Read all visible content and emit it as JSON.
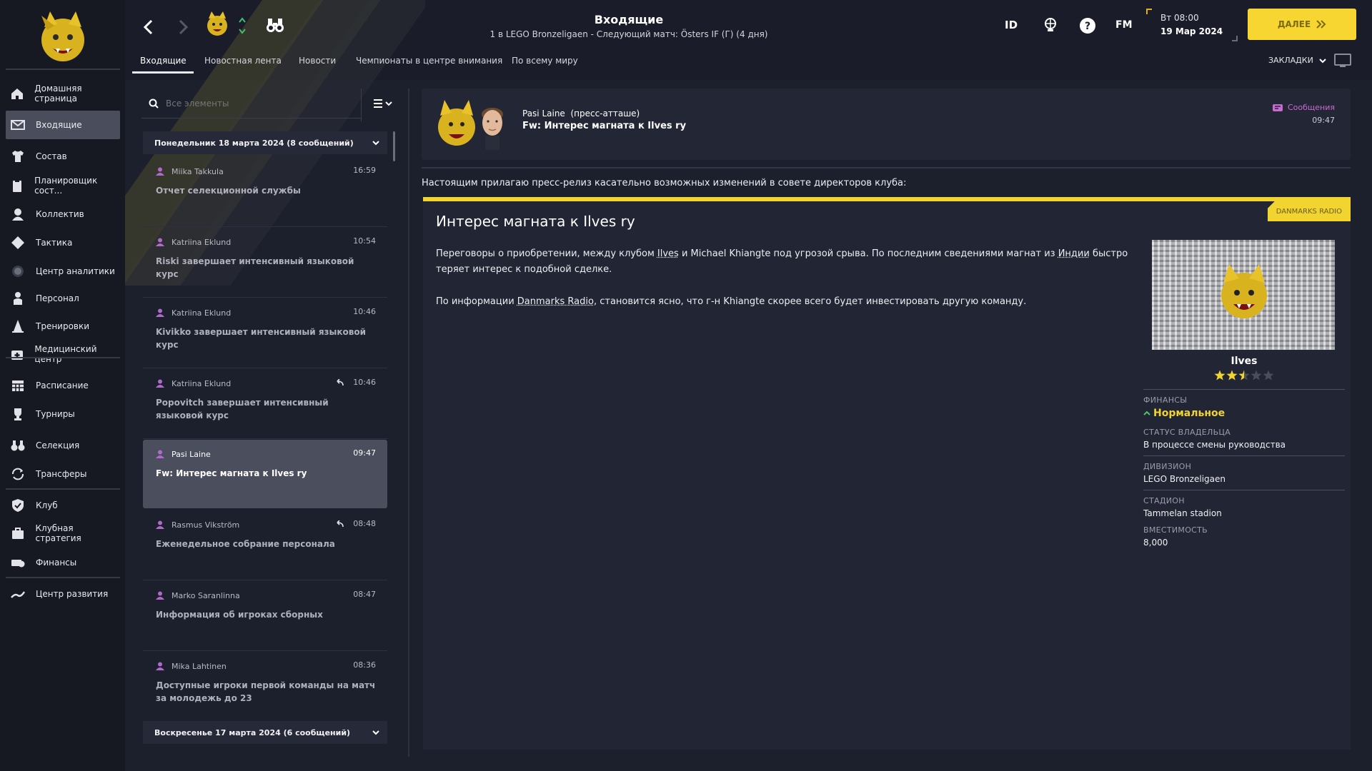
{
  "sidebar": {
    "items": [
      {
        "label": "Домашняя страница",
        "icon": "home-icon"
      },
      {
        "label": "Входящие",
        "icon": "mail-icon"
      },
      {
        "label": "Состав",
        "icon": "shirt-icon"
      },
      {
        "label": "Планировщик сост...",
        "icon": "clipboard-icon"
      },
      {
        "label": "Коллектив",
        "icon": "group-icon"
      },
      {
        "label": "Тактика",
        "icon": "tactics-icon"
      },
      {
        "label": "Центр аналитики",
        "icon": "analytics-icon"
      },
      {
        "label": "Персонал",
        "icon": "staff-icon"
      },
      {
        "label": "Тренировки",
        "icon": "cone-icon"
      },
      {
        "label": "Медицинский центр",
        "icon": "medical-icon"
      },
      {
        "label": "Расписание",
        "icon": "calendar-icon"
      },
      {
        "label": "Турниры",
        "icon": "trophy-icon"
      },
      {
        "label": "Селекция",
        "icon": "binoculars-icon"
      },
      {
        "label": "Трансферы",
        "icon": "transfer-icon"
      },
      {
        "label": "Клуб",
        "icon": "shield-icon"
      },
      {
        "label": "Клубная стратегия",
        "icon": "briefcase-icon"
      },
      {
        "label": "Финансы",
        "icon": "money-icon"
      },
      {
        "label": "Центр развития",
        "icon": "development-icon"
      }
    ]
  },
  "header": {
    "title": "Входящие",
    "subtitle": "1 в LEGO Bronzeligaen - Следующий матч: Östers IF (Г) (4 дня)",
    "id_label": "ID",
    "fm_label": "FM",
    "date_line1": "Вт 08:00",
    "date_line2": "19 Мар 2024",
    "continue_label": "ДАЛЕЕ",
    "bookmarks_label": "ЗАКЛАДКИ",
    "tabs": [
      "Входящие",
      "Новостная лента",
      "Новости",
      "Чемпионаты в центре внимания",
      "По всему миру"
    ]
  },
  "inbox": {
    "search_placeholder": "Все элементы",
    "group1": "Понедельник 18 марта 2024 (8 сообщений)",
    "group2": "Воскресенье 17 марта 2024 (6 сообщений)",
    "messages": [
      {
        "sender": "Miika Takkula",
        "time": "16:59",
        "subject": "Отчет селекционной службы"
      },
      {
        "sender": "Katriina Eklund",
        "time": "10:54",
        "subject": "Riski завершает интенсивный языковой курс"
      },
      {
        "sender": "Katriina Eklund",
        "time": "10:46",
        "subject": "Kivikko завершает интенсивный языковой курс"
      },
      {
        "sender": "Katriina Eklund",
        "time": "10:46",
        "subject": "Popovitch завершает интенсивный языковой курс"
      },
      {
        "sender": "Pasi Laine",
        "time": "09:47",
        "subject": "Fw: Интерес магната к Ilves ry"
      },
      {
        "sender": "Rasmus Vikström",
        "time": "08:48",
        "subject": "Еженедельное собрание персонала"
      },
      {
        "sender": "Marko Saranlinna",
        "time": "08:47",
        "subject": "Информация об игроках сборных"
      },
      {
        "sender": "Mika Lahtinen",
        "time": "08:36",
        "subject": "Доступные игроки первой команды на матч за молодежь до 23"
      }
    ]
  },
  "message": {
    "sender": "Pasi Laine",
    "role": "(пресс-атташе)",
    "subject": "Fw: Интерес магната к Ilves ry",
    "type_label": "Сообщения",
    "time": "09:47",
    "intro": "Настоящим прилагаю пресс-релиз касательно возможных изменений в совете директоров клуба:",
    "source_tag": "DANMARKS RADIO",
    "article_title": "Интерес магната к Ilves ry",
    "para1": {
      "a": "Переговоры о приобретении, между клубом ",
      "club": "Ilves",
      "b": " и Michael Khiangte под угрозой срыва. По последним сведениями магнат из ",
      "country": "Индии",
      "c": " быстро теряет интерес к подобной сделке."
    },
    "para2": {
      "a": "По информации ",
      "source": "Danmarks Radio",
      "b": ", становится ясно, что г-н Khiangte скорее всего будет инвестировать другую команду."
    }
  },
  "club_card": {
    "name": "Ilves",
    "rating_stars": 2.5,
    "rating_max": 5,
    "finance_label": "ФИНАНСЫ",
    "finance_value": "Нормальное",
    "owner_label": "СТАТУС ВЛАДЕЛЬЦА",
    "owner_value": "В процессе смены руководства",
    "division_label": "ДИВИЗИОН",
    "division_value": "LEGO Bronzeligaen",
    "stadium_label": "СТАДИОН",
    "stadium_value": "Tammelan stadion",
    "capacity_label": "ВМЕСТИМОСТЬ",
    "capacity_value": "8,000"
  },
  "colors": {
    "accent": "#f2d431",
    "positive": "#4cc46a",
    "tag": "#c86bd0"
  }
}
